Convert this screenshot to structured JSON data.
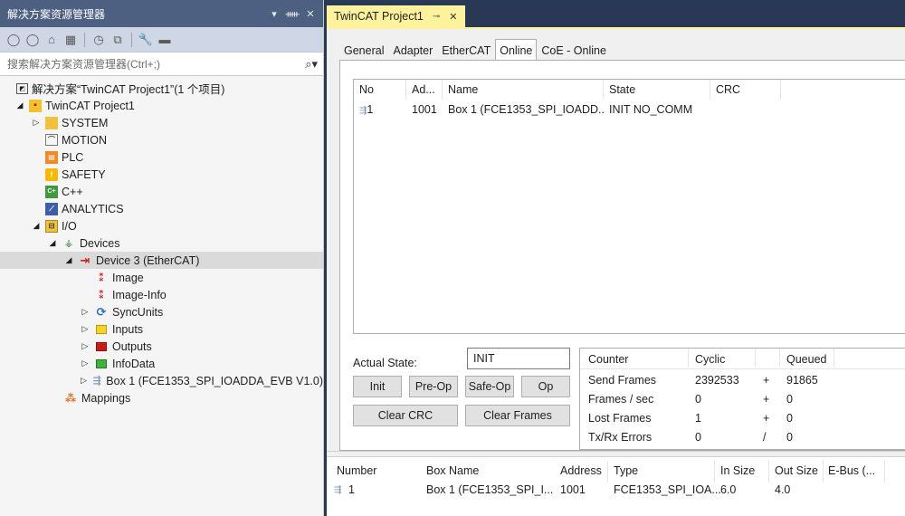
{
  "solution_explorer": {
    "title": "解决方案资源管理器",
    "title_buttons": [
      "▾",
      "ᚔ",
      "✕"
    ],
    "search_placeholder": "搜索解决方案资源管理器(Ctrl+;)",
    "tree": {
      "solution": "解决方案“TwinCAT Project1”(1 个项目)",
      "project": "TwinCAT Project1",
      "system": "SYSTEM",
      "motion": "MOTION",
      "plc": "PLC",
      "safety": "SAFETY",
      "cpp": "C++",
      "analytics": "ANALYTICS",
      "io": "I/O",
      "devices": "Devices",
      "device3": "Device 3 (EtherCAT)",
      "image": "Image",
      "image_info": "Image-Info",
      "syncunits": "SyncUnits",
      "inputs": "Inputs",
      "outputs": "Outputs",
      "infodata": "InfoData",
      "box1": "Box 1 (FCE1353_SPI_IOADDA_EVB V1.0)",
      "mappings": "Mappings"
    }
  },
  "document": {
    "tab_title": "TwinCAT Project1",
    "tabs": [
      "General",
      "Adapter",
      "EtherCAT",
      "Online",
      "CoE - Online"
    ],
    "active_tab": "Online",
    "slave_list": {
      "headers": [
        "No",
        "Ad...",
        "Name",
        "State",
        "CRC"
      ],
      "rows": [
        {
          "no": "1",
          "addr": "1001",
          "name": "Box 1 (FCE1353_SPI_IOADD...",
          "state": "INIT NO_COMM",
          "crc": ""
        }
      ]
    },
    "actual_state_label": "Actual State:",
    "actual_state_value": "INIT",
    "buttons": {
      "init": "Init",
      "preop": "Pre-Op",
      "safeop": "Safe-Op",
      "op": "Op",
      "clear_crc": "Clear CRC",
      "clear_frames": "Clear Frames"
    },
    "counters": {
      "headers": [
        "Counter",
        "Cyclic",
        "Queued"
      ],
      "rows": [
        {
          "label": "Send Frames",
          "cyclic": "2392533",
          "op": "+",
          "queued": "91865"
        },
        {
          "label": "Frames / sec",
          "cyclic": "0",
          "op": "+",
          "queued": "0"
        },
        {
          "label": "Lost Frames",
          "cyclic": "1",
          "op": "+",
          "queued": "0"
        },
        {
          "label": "Tx/Rx Errors",
          "cyclic": "0",
          "op": "/",
          "queued": "0"
        }
      ]
    },
    "bottom_list": {
      "headers": [
        "Number",
        "Box Name",
        "Address",
        "Type",
        "In Size",
        "Out Size",
        "E-Bus (..."
      ],
      "rows": [
        {
          "number": "1",
          "box_name": "Box 1 (FCE1353_SPI_I...",
          "address": "1001",
          "type": "FCE1353_SPI_IOA...",
          "in_size": "6.0",
          "out_size": "4.0",
          "ebus": ""
        }
      ]
    }
  },
  "colors": {
    "vs_frame": "#293955",
    "explorer_title": "#4d6082",
    "doc_tab": "#fff29d",
    "selected_row": "#dadada"
  }
}
